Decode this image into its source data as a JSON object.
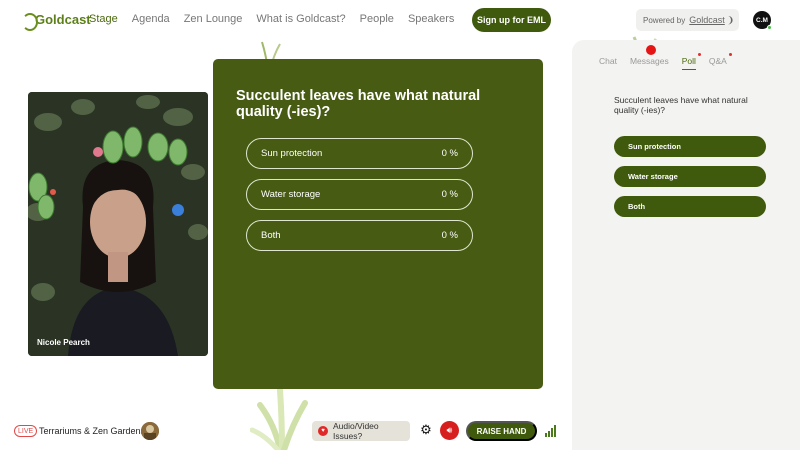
{
  "brand": {
    "name": "Goldcast"
  },
  "nav": {
    "links": [
      "Stage",
      "Agenda",
      "Zen Lounge",
      "What is Goldcast?",
      "People",
      "Speakers"
    ],
    "signup_label": "Sign up for EML"
  },
  "powered_by": {
    "label": "Powered by",
    "brand": "Goldcast"
  },
  "user": {
    "initials": "C.M"
  },
  "video": {
    "speaker_name": "Nicole Pearch"
  },
  "poll": {
    "question": "Succulent leaves have what natural quality (-ies)?",
    "options": [
      {
        "label": "Sun protection",
        "percent": "0 %"
      },
      {
        "label": "Water storage",
        "percent": "0 %"
      },
      {
        "label": "Both",
        "percent": "0 %"
      }
    ]
  },
  "sidebar": {
    "tabs": [
      "Chat",
      "Messages",
      "Poll",
      "Q&A"
    ],
    "active_tab": "Poll",
    "question": "Succulent leaves have what natural quality (-ies)?",
    "options": [
      "Sun protection",
      "Water storage",
      "Both"
    ]
  },
  "bottom": {
    "live_label": "LIVE",
    "event_title": "Terrariums & Zen Gardens",
    "av_issues_label": "Audio/Video Issues?",
    "raise_hand_label": "RAISE HAND"
  },
  "colors": {
    "primary": "#3f5a0c",
    "poll_bg": "#475b13",
    "sidebar_bg": "#f3f3f1",
    "alert": "#d71e1e"
  }
}
